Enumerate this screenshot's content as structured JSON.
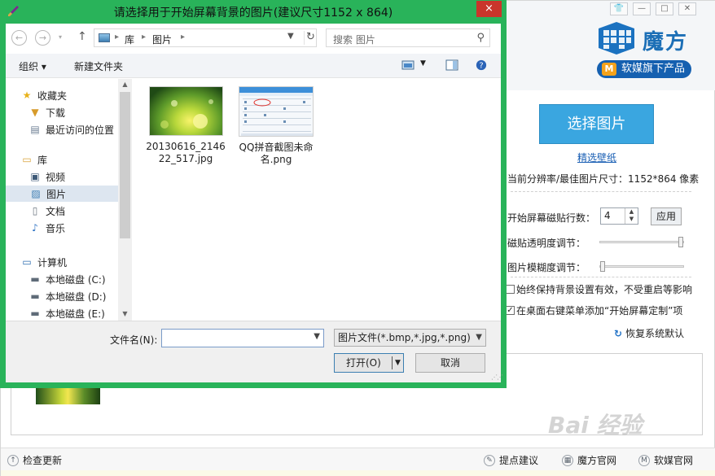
{
  "dialog": {
    "title": "请选择用于开始屏幕背景的图片(建议尺寸1152 x 864)",
    "close_icon": "×",
    "breadcrumb": [
      "库",
      "图片"
    ],
    "search_placeholder": "搜索 图片",
    "toolbar": {
      "organize": "组织 ▾",
      "new_folder": "新建文件夹"
    },
    "nav": {
      "favorites": "收藏夹",
      "downloads": "下载",
      "recent": "最近访问的位置",
      "libraries": "库",
      "videos": "视频",
      "pictures": "图片",
      "documents": "文档",
      "music": "音乐",
      "computer": "计算机",
      "disk_c": "本地磁盘 (C:)",
      "disk_d": "本地磁盘 (D:)",
      "disk_e": "本地磁盘 (E:)"
    },
    "files": [
      {
        "name": "20130616_214622_517.jpg"
      },
      {
        "name": "QQ拼音截图未命名.png"
      }
    ],
    "filename_label": "文件名(N):",
    "filename_value": "",
    "filter": "图片文件(*.bmp,*.jpg,*.png)",
    "open_label": "打开(O)",
    "cancel_label": "取消"
  },
  "app": {
    "logo_text": "魔方",
    "brand_m": "M",
    "brand_badge": "软媒旗下产品",
    "choose_button": "选择图片",
    "wallpaper_link": "精选壁纸",
    "resolution": "当前分辨率/最佳图片尺寸：1152*864 像素",
    "rows_label": "开始屏幕磁贴行数：",
    "rows_value": "4",
    "apply_label": "应用",
    "transparency_label": "磁贴透明度调节：",
    "blur_label": "图片模糊度调节：",
    "transparency_level": 1.0,
    "blur_level": 0.0,
    "check1": {
      "label": "始终保持背景设置有效，不受重启等影响",
      "checked": false
    },
    "check2": {
      "label": "在桌面右键菜单添加“开始屏幕定制”项",
      "checked": true
    },
    "restore_label": "恢复系统默认",
    "status": {
      "update": "检查更新",
      "suggest": "提点建议",
      "mofang_site": "魔方官网",
      "ruanmei_site": "软媒官网"
    },
    "watermark": "Bai 经验"
  },
  "colors": {
    "dialog_frame": "#29b35a",
    "close": "#c9352b",
    "primary_button": "#3aa6e0",
    "brand": "#1560b0"
  }
}
